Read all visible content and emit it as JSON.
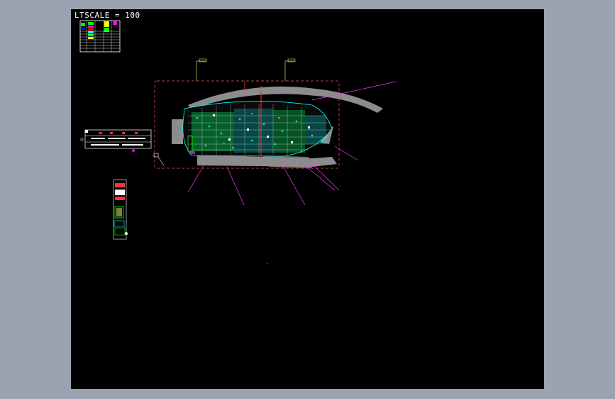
{
  "viewport": {
    "background": "#000000",
    "frame_color": "#9ba3b1"
  },
  "annotation": {
    "ltscale_text": "LTSCALE = 100"
  },
  "colors": {
    "leader": "#ff33ff",
    "frame_red": "#ff5555",
    "cyan": "#00ffff",
    "green": "#00ff66",
    "grey": "#8c8c8c",
    "yellow": "#ffff66",
    "white": "#ffffff"
  },
  "icons": {
    "ucs": "ucs-icon",
    "crosshair": "crosshair-cursor-icon"
  }
}
